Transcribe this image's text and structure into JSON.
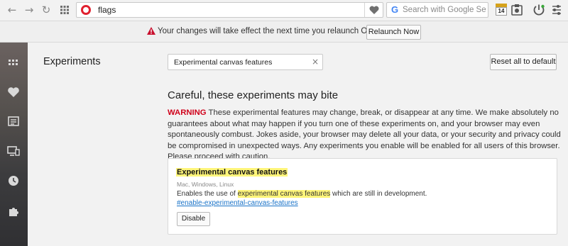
{
  "toolbar": {
    "back_glyph": "←",
    "forward_glyph": "→",
    "reload_glyph": "↻",
    "address_value": "flags",
    "search_placeholder": "Search with Google Se",
    "calendar_badge": "14"
  },
  "infobar": {
    "message": "Your changes will take effect the next time you relaunch Opera.",
    "relaunch_label": "Relaunch Now"
  },
  "sidebar": {
    "items": [
      "speed-dial",
      "bookmarks",
      "news",
      "tabs-sync",
      "history",
      "extensions"
    ]
  },
  "main": {
    "page_title": "Experiments",
    "search_value": "Experimental canvas features",
    "clear_glyph": "×",
    "reset_label": "Reset all to default",
    "heading": "Careful, these experiments may bite",
    "warning_word": "WARNING",
    "warning_text": " These experimental features may change, break, or disappear at any time. We make absolutely no guarantees about what may happen if you turn one of these experiments on, and your browser may even spontaneously combust. Jokes aside, your browser may delete all your data, or your security and privacy could be compromised in unexpected ways. Any experiments you enable will be enabled for all users of this browser. Please proceed with caution."
  },
  "experiment": {
    "title": "Experimental canvas features",
    "platforms": "Mac, Windows, Linux",
    "desc_prefix": "Enables the use of ",
    "desc_highlight": "experimental canvas features",
    "desc_suffix": " which are still in development.",
    "link": "#enable-experimental-canvas-features",
    "button_label": "Disable"
  },
  "colors": {
    "opera_red": "#e0202e",
    "warning_red": "#d0021b",
    "highlight": "#fff57a",
    "link_blue": "#1a73c8"
  }
}
